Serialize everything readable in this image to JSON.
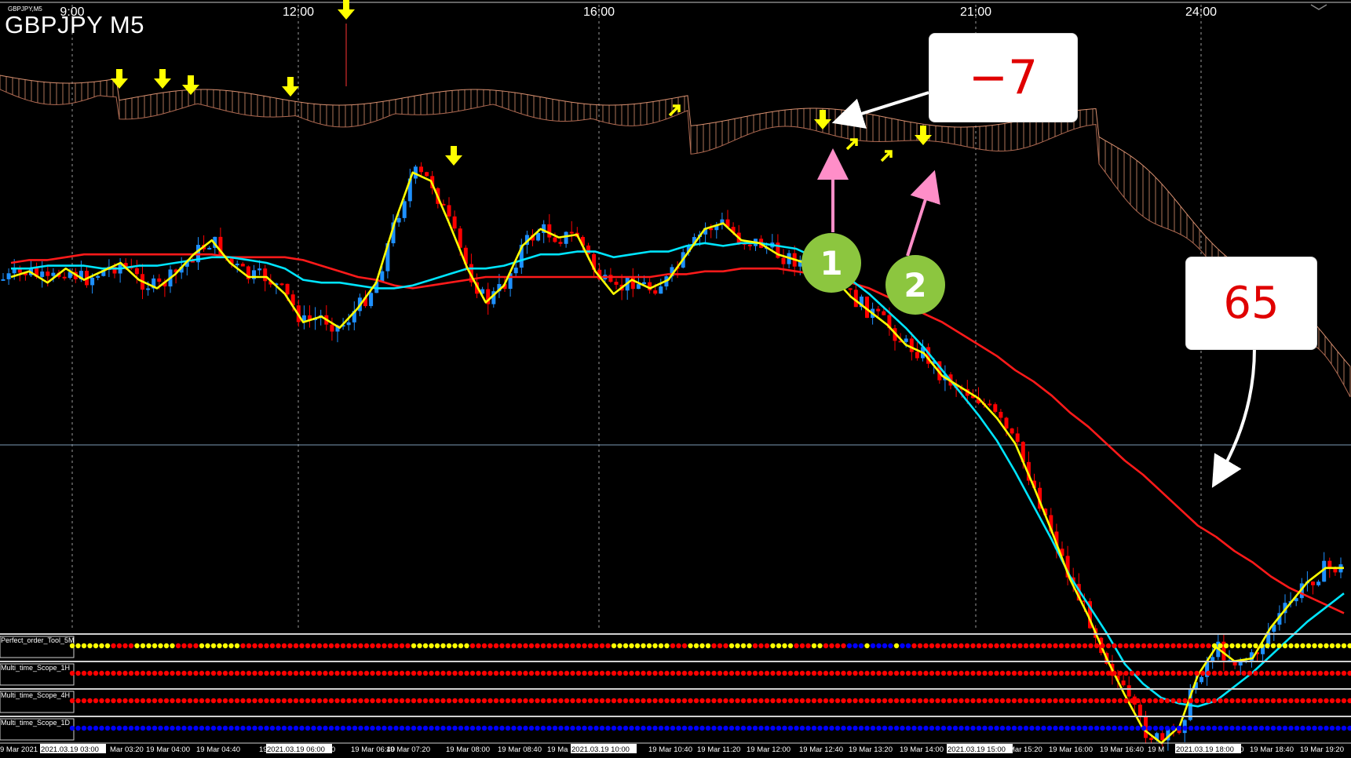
{
  "header": {
    "symbol_title": "GBPJPY M5",
    "symbol_small": "GBPJPY,M5"
  },
  "callouts": {
    "loss": "−7",
    "profit": "65"
  },
  "badges": [
    "1",
    "2"
  ],
  "colors": {
    "background": "#000000",
    "bull_candle": "#1e90ff",
    "bear_candle": "#ff0000",
    "ma_fast": "#ffff00",
    "ma_mid": "#00e5ff",
    "ma_slow": "#ff1a1a",
    "ichimoku_cloud": "#d99070",
    "signal_arrow": "#ffff00",
    "pointer_pink": "#ff8ec8",
    "badge_green": "#8cc63f",
    "dot_red": "#ff0000",
    "dot_yellow": "#ffff00",
    "dot_blue": "#0000ff"
  },
  "chart_data": {
    "type": "candlestick",
    "symbol": "GBPJPY",
    "timeframe": "M5",
    "top_axis_labels": [
      "9:00",
      "12:00",
      "16:00",
      "21:00",
      "24:00"
    ],
    "bottom_axis_labels": [
      "9 Mar 2021",
      "2021.03.19 03:00",
      "Mar 03:20",
      "19 Mar 04:00",
      "19 Mar 04:40",
      "19 Mar",
      "2021.03.19 06:00",
      ":00",
      "19 Mar 06:40",
      "19 Mar 07:20",
      "19 Mar 08:00",
      "19 Mar 08:40",
      "19 Ma",
      "2021.03.19 10:00",
      "19 Mar 10:40",
      "19 Mar 11:20",
      "19 Mar 12:00",
      "19 Mar 12:40",
      "19 Mar 13:20",
      "19 Mar 14:00",
      "2021.03.19 15:00",
      "Mar 15:20",
      "19 Mar 16:00",
      "19 Mar 16:40",
      "19 M",
      "2021.03.19 18:00",
      "00",
      "19 Mar 18:40",
      "19 Mar 19:20"
    ],
    "indicators": [
      "Perfect_order_Tool_5M",
      "Multi_time_Scope_1H",
      "Multi_time_Scope_4H",
      "Multi_time_Scope_1D"
    ],
    "series": [
      {
        "values": [
          0.45,
          0.47,
          0.43,
          0.48,
          0.44,
          0.47,
          0.5,
          0.44,
          0.41,
          0.46,
          0.53,
          0.58,
          0.5,
          0.45,
          0.45,
          0.39,
          0.29,
          0.31,
          0.27,
          0.34,
          0.43,
          0.64,
          0.82,
          0.79,
          0.64,
          0.48,
          0.36,
          0.42,
          0.56,
          0.62,
          0.59,
          0.6,
          0.47,
          0.39,
          0.44,
          0.41,
          0.44,
          0.53,
          0.62,
          0.64,
          0.58,
          0.57,
          0.53,
          0.51,
          0.49,
          0.45,
          0.38,
          0.33,
          0.28,
          0.21,
          0.18,
          0.1,
          0.06,
          0.02,
          -0.05,
          -0.14,
          -0.29,
          -0.45,
          -0.62,
          -0.75,
          -0.9,
          -1.03,
          -1.15,
          -1.2,
          -1.14,
          -0.96,
          -0.86,
          -0.91,
          -0.9,
          -0.79,
          -0.71,
          -0.63,
          -0.58,
          -0.58
        ]
      },
      {
        "values": [
          0.48,
          0.48,
          0.49,
          0.49,
          0.49,
          0.48,
          0.48,
          0.49,
          0.49,
          0.5,
          0.51,
          0.52,
          0.52,
          0.51,
          0.5,
          0.48,
          0.44,
          0.43,
          0.43,
          0.42,
          0.41,
          0.41,
          0.42,
          0.44,
          0.46,
          0.48,
          0.48,
          0.49,
          0.51,
          0.53,
          0.53,
          0.54,
          0.54,
          0.52,
          0.53,
          0.54,
          0.54,
          0.56,
          0.57,
          0.56,
          0.57,
          0.57,
          0.56,
          0.55,
          0.52,
          0.48,
          0.44,
          0.39,
          0.33,
          0.27,
          0.2,
          0.12,
          0.04,
          -0.04,
          -0.13,
          -0.24,
          -0.36,
          -0.48,
          -0.61,
          -0.71,
          -0.81,
          -0.92,
          -0.99,
          -1.04,
          -1.06,
          -1.07,
          -1.05,
          -1.0,
          -0.95,
          -0.89,
          -0.83,
          -0.77,
          -0.72,
          -0.67
        ]
      },
      {
        "values": [
          0.5,
          0.51,
          0.51,
          0.52,
          0.53,
          0.53,
          0.53,
          0.53,
          0.53,
          0.53,
          0.53,
          0.53,
          0.52,
          0.52,
          0.52,
          0.52,
          0.51,
          0.49,
          0.47,
          0.45,
          0.44,
          0.42,
          0.41,
          0.42,
          0.43,
          0.44,
          0.45,
          0.45,
          0.45,
          0.45,
          0.45,
          0.45,
          0.45,
          0.45,
          0.45,
          0.45,
          0.46,
          0.46,
          0.47,
          0.47,
          0.48,
          0.48,
          0.48,
          0.47,
          0.46,
          0.45,
          0.43,
          0.41,
          0.38,
          0.35,
          0.32,
          0.29,
          0.25,
          0.21,
          0.17,
          0.12,
          0.08,
          0.03,
          -0.03,
          -0.08,
          -0.14,
          -0.2,
          -0.25,
          -0.31,
          -0.37,
          -0.43,
          -0.47,
          -0.52,
          -0.56,
          -0.61,
          -0.65,
          -0.68,
          -0.71,
          -0.74
        ]
      }
    ]
  }
}
